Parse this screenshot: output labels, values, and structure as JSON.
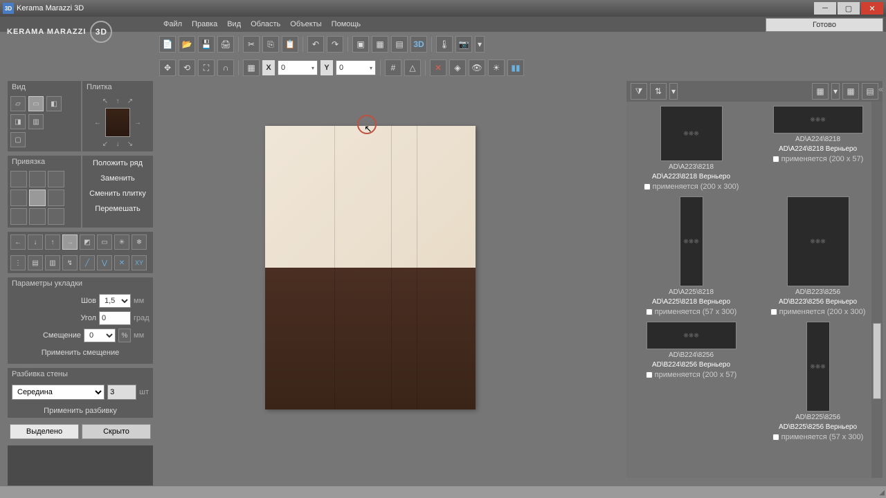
{
  "app": {
    "title": "Kerama Marazzi 3D",
    "icon": "3D"
  },
  "status": "Готово",
  "menu": [
    "Файл",
    "Правка",
    "Вид",
    "Область",
    "Объекты",
    "Помощь"
  ],
  "logo": {
    "text": "KERAMA MARAZZI",
    "badge": "3D"
  },
  "coords": {
    "x": "0",
    "y": "0"
  },
  "panels": {
    "view": {
      "title": "Вид"
    },
    "tile": {
      "title": "Плитка"
    },
    "actions": [
      "Положить ряд",
      "Заменить",
      "Сменить плитку",
      "Перемешать"
    ],
    "anchor": {
      "title": "Привязка"
    },
    "params": {
      "title": "Параметры укладки",
      "seam_label": "Шов",
      "seam": "1,5",
      "seam_unit": "мм",
      "angle_label": "Угол",
      "angle": "0",
      "angle_unit": "град",
      "offset_label": "Смещение",
      "offset": "0",
      "offset_pct": "%",
      "offset_unit": "мм",
      "apply": "Применить смещение"
    },
    "split": {
      "title": "Разбивка стены",
      "mode": "Середина",
      "count": "3",
      "unit": "шт",
      "apply": "Применить разбивку"
    },
    "selected": "Выделено",
    "hidden": "Скрыто"
  },
  "catalog": [
    {
      "code": "AD\\A223\\8218",
      "name": "AD\\A223\\8218 Верньеро",
      "meta": "применяется (200 x 300)",
      "w": 90,
      "h": 80
    },
    {
      "code": "AD\\A224\\8218",
      "name": "AD\\A224\\8218 Верньеро",
      "meta": "применяется (200 x 57)",
      "w": 130,
      "h": 40
    },
    {
      "code": "AD\\A225\\8218",
      "name": "AD\\A225\\8218 Верньеро",
      "meta": "применяется (57 x 300)",
      "w": 34,
      "h": 130
    },
    {
      "code": "AD\\B223\\8256",
      "name": "AD\\B223\\8256 Верньеро",
      "meta": "применяется (200 x 300)",
      "w": 90,
      "h": 130
    },
    {
      "code": "AD\\B224\\8256",
      "name": "AD\\B224\\8256 Верньеро",
      "meta": "применяется (200 x 57)",
      "w": 130,
      "h": 40
    },
    {
      "code": "AD\\B225\\8256",
      "name": "AD\\B225\\8256 Верньеро",
      "meta": "применяется (57 x 300)",
      "w": 34,
      "h": 130
    }
  ]
}
